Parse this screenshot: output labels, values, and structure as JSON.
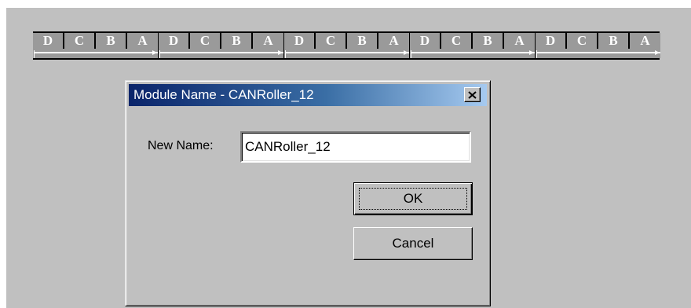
{
  "modules": [
    {
      "cells": [
        "D",
        "C",
        "B",
        "A"
      ]
    },
    {
      "cells": [
        "D",
        "C",
        "B",
        "A"
      ]
    },
    {
      "cells": [
        "D",
        "C",
        "B",
        "A"
      ]
    },
    {
      "cells": [
        "D",
        "C",
        "B",
        "A"
      ]
    },
    {
      "cells": [
        "D",
        "C",
        "B",
        "A"
      ]
    }
  ],
  "dialog": {
    "title": "Module Name - CANRoller_12",
    "close_icon": "close-icon",
    "new_name_label": "New Name:",
    "new_name_value": "CANRoller_12",
    "ok_label": "OK",
    "cancel_label": "Cancel"
  },
  "colors": {
    "background": "#c0c0c0",
    "title_bar_start": "#0a246a",
    "title_bar_end": "#a6caf0",
    "module_cell": "#9a9a9a",
    "module_border": "#000000"
  }
}
